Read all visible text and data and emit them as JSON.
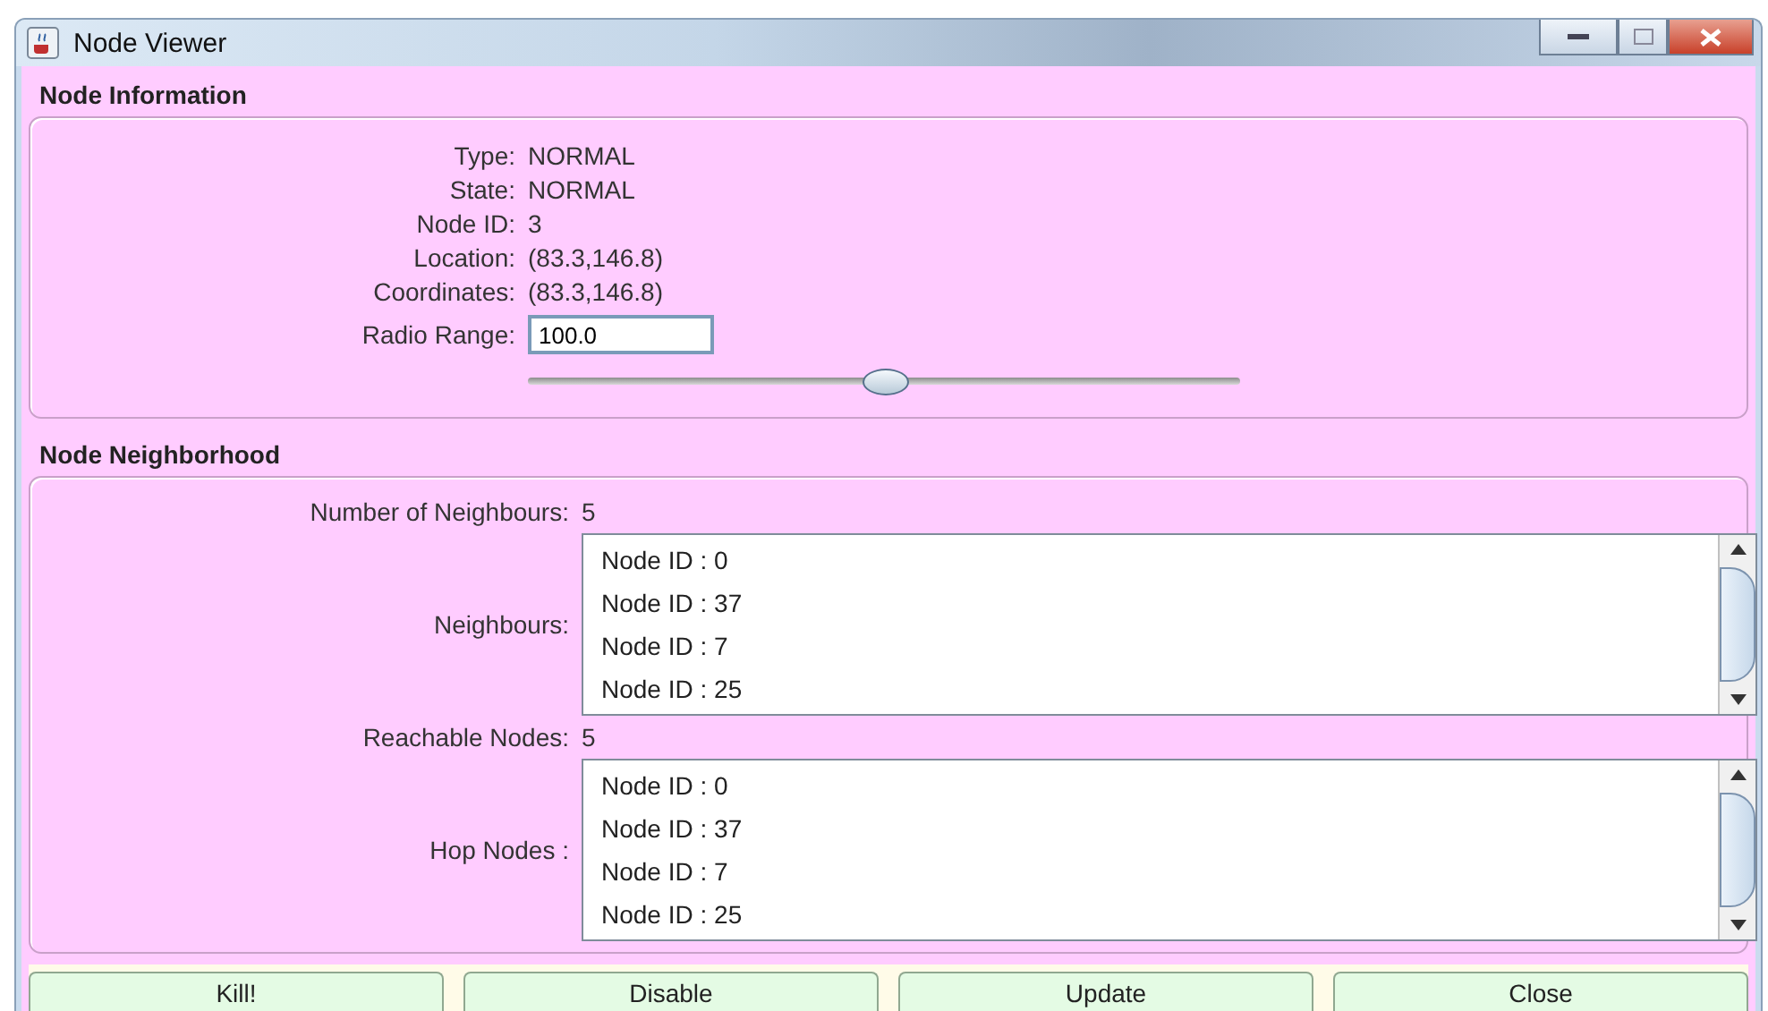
{
  "window": {
    "title": "Node Viewer"
  },
  "node_information": {
    "title": "Node Information",
    "fields": [
      {
        "label": "Type:",
        "value": "NORMAL"
      },
      {
        "label": "State:",
        "value": "NORMAL"
      },
      {
        "label": "Node ID:",
        "value": "3"
      },
      {
        "label": "Location:",
        "value": "(83.3,146.8)"
      },
      {
        "label": "Coordinates:",
        "value": "(83.3,146.8)"
      }
    ],
    "radio_range": {
      "label": "Radio Range:",
      "value": "100.0"
    },
    "slider": {
      "level": 0.5
    }
  },
  "node_neighborhood": {
    "title": "Node Neighborhood",
    "neighbour_count": {
      "label": "Number of Neighbours:",
      "value": "5"
    },
    "neighbours": {
      "label": "Neighbours:",
      "items": [
        "Node ID : 0",
        "Node ID : 37",
        "Node ID : 7",
        "Node ID : 25"
      ]
    },
    "reachable_count": {
      "label": "Reachable Nodes:",
      "value": "5"
    },
    "hop_nodes": {
      "label": "Hop Nodes :",
      "items": [
        "Node ID : 0",
        "Node ID : 37",
        "Node ID : 7",
        "Node ID : 25"
      ]
    }
  },
  "buttons": [
    "Kill!",
    "Disable",
    "Update",
    "Close"
  ]
}
